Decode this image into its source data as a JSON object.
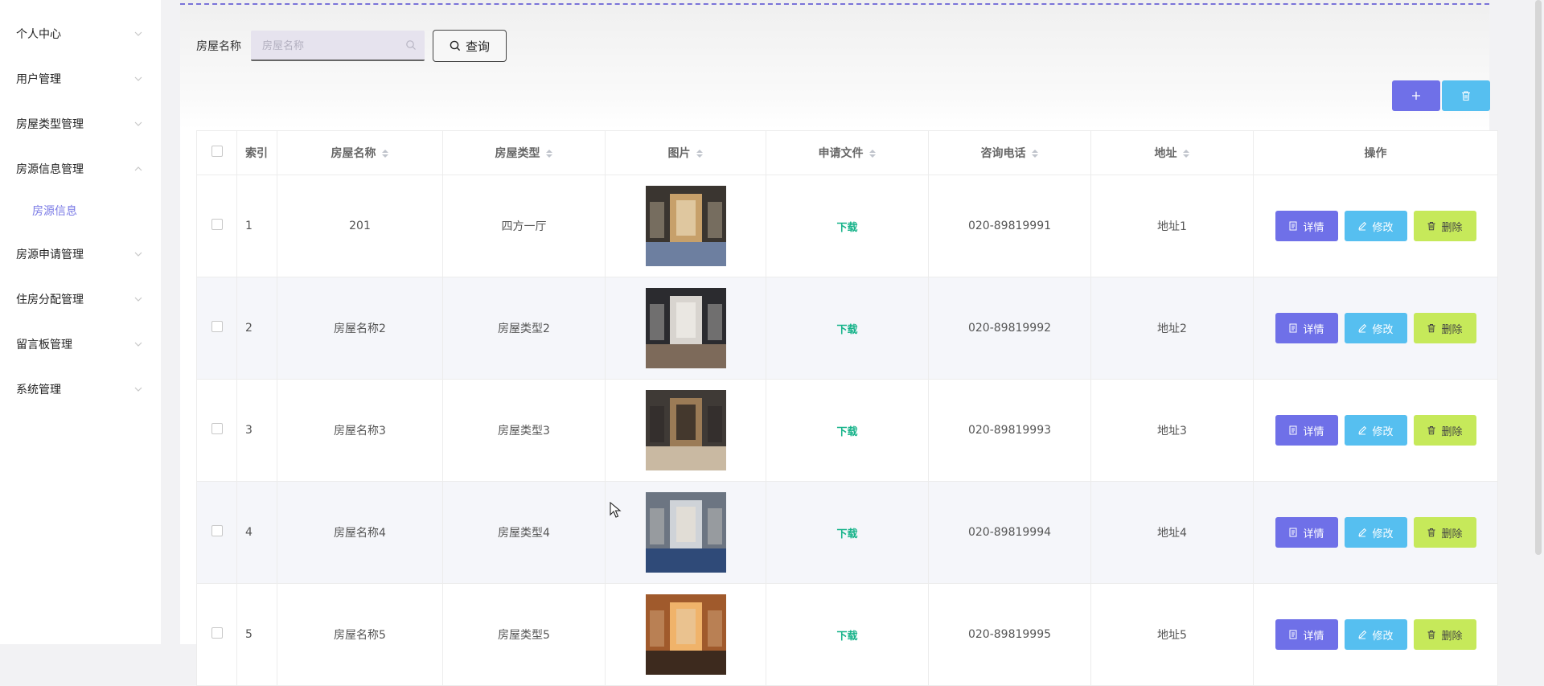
{
  "sidebar": {
    "items": [
      {
        "label": "个人中心",
        "expanded": false
      },
      {
        "label": "用户管理",
        "expanded": false
      },
      {
        "label": "房屋类型管理",
        "expanded": false
      },
      {
        "label": "房源信息管理",
        "expanded": true,
        "children": [
          {
            "label": "房源信息"
          }
        ]
      },
      {
        "label": "房源申请管理",
        "expanded": false
      },
      {
        "label": "住房分配管理",
        "expanded": false
      },
      {
        "label": "留言板管理",
        "expanded": false
      },
      {
        "label": "系统管理",
        "expanded": false
      }
    ]
  },
  "search": {
    "label": "房屋名称",
    "placeholder": "房屋名称",
    "value": "",
    "query_label": "查询"
  },
  "toolbar": {
    "add_icon": "plus-icon",
    "delete_icon": "trash-icon"
  },
  "table": {
    "headers": {
      "index": "索引",
      "name": "房屋名称",
      "type": "房屋类型",
      "image": "图片",
      "file": "申请文件",
      "phone": "咨询电话",
      "address": "地址",
      "ops": "操作"
    },
    "rows": [
      {
        "index": "1",
        "name": "201",
        "type": "四方一厅",
        "file": "下载",
        "phone": "020-89819991",
        "address": "地址1"
      },
      {
        "index": "2",
        "name": "房屋名称2",
        "type": "房屋类型2",
        "file": "下载",
        "phone": "020-89819992",
        "address": "地址2"
      },
      {
        "index": "3",
        "name": "房屋名称3",
        "type": "房屋类型3",
        "file": "下载",
        "phone": "020-89819993",
        "address": "地址3"
      },
      {
        "index": "4",
        "name": "房屋名称4",
        "type": "房屋类型4",
        "file": "下载",
        "phone": "020-89819994",
        "address": "地址4"
      },
      {
        "index": "5",
        "name": "房屋名称5",
        "type": "房屋类型5",
        "file": "下载",
        "phone": "020-89819995",
        "address": "地址5"
      }
    ],
    "actions": {
      "detail": "详情",
      "edit": "修改",
      "delete": "删除"
    }
  },
  "colors": {
    "accent": "#6f70e8",
    "edit": "#56bff0",
    "delete": "#c6e95a",
    "download": "#17b38a",
    "submenu_active": "#7a7ae6"
  }
}
